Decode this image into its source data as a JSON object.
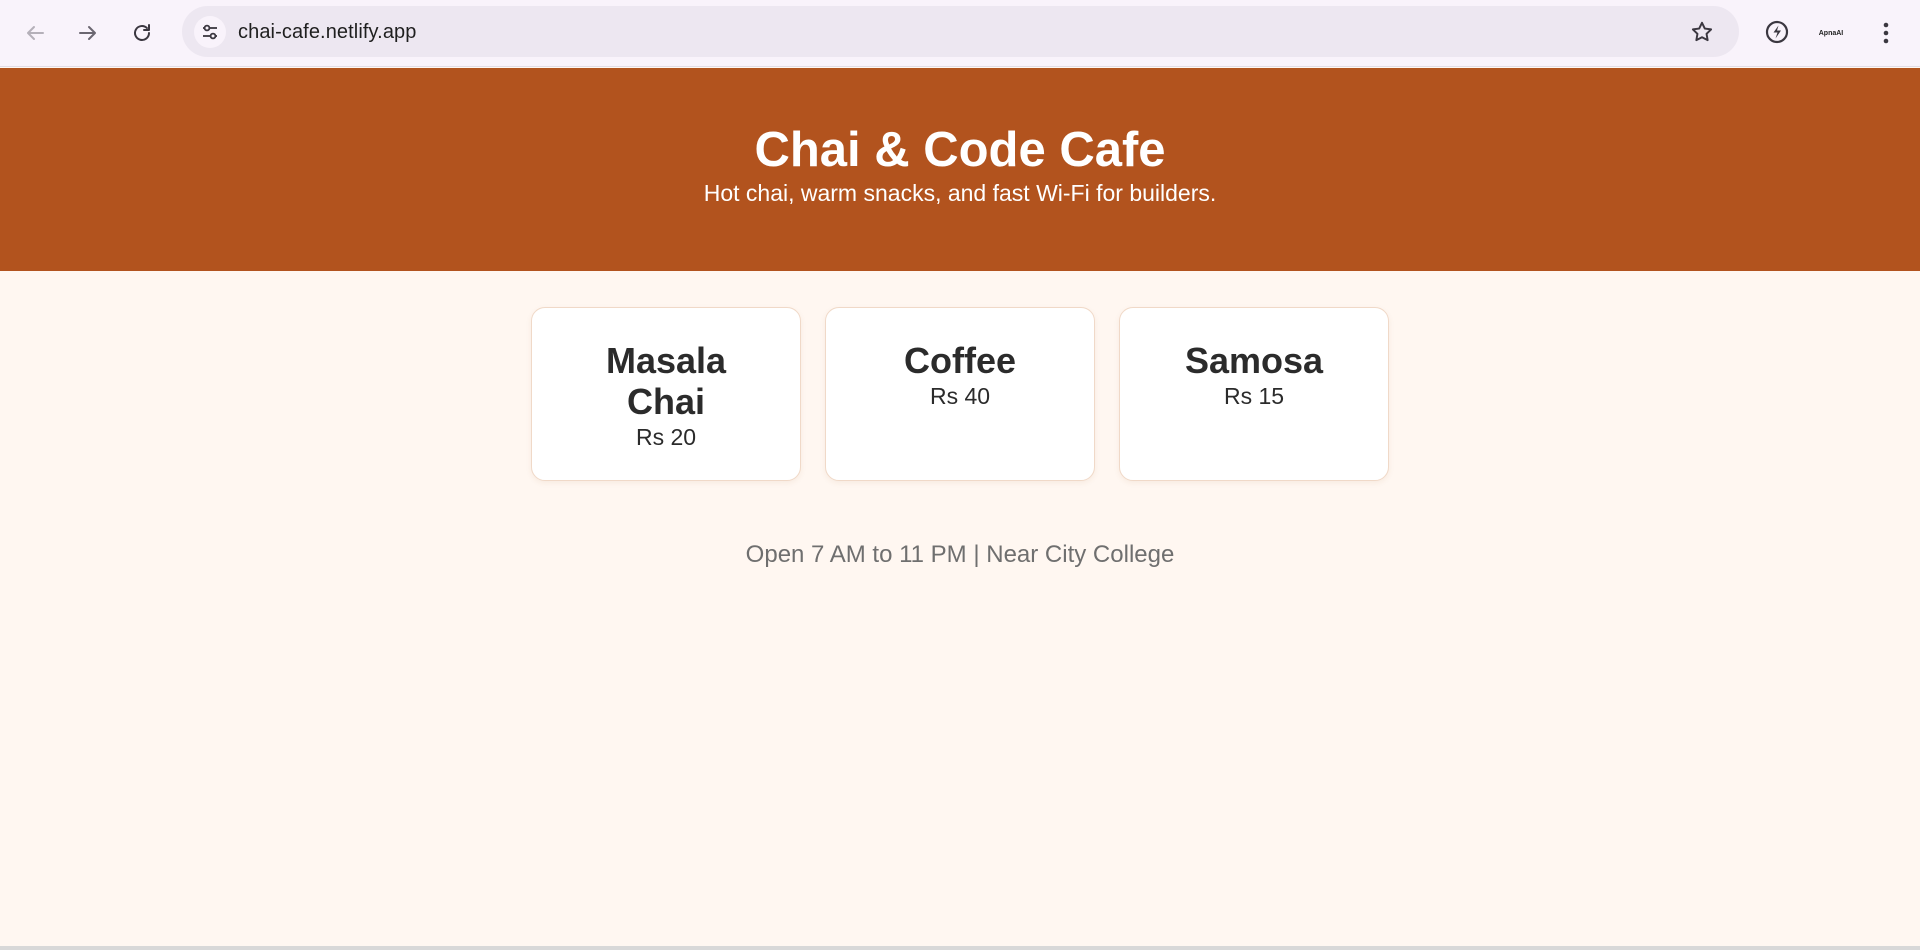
{
  "browser": {
    "url": "chai-cafe.netlify.app",
    "profile_label": "ApnaAI",
    "icons": {
      "back": "arrow-left-icon",
      "forward": "arrow-right-icon",
      "reload": "reload-icon",
      "site_info": "tune-icon",
      "bookmark": "star-icon",
      "extension": "leaf-bolt-icon",
      "menu": "three-dots-icon"
    }
  },
  "hero": {
    "title": "Chai & Code Cafe",
    "tagline": "Hot chai, warm snacks, and fast Wi-Fi for builders.",
    "background": "#b2531e"
  },
  "menu": {
    "items": [
      {
        "name": "Masala Chai",
        "price": "Rs 20"
      },
      {
        "name": "Coffee",
        "price": "Rs 40"
      },
      {
        "name": "Samosa",
        "price": "Rs 15"
      }
    ]
  },
  "footer": {
    "note": "Open 7 AM to 11 PM | Near City College"
  },
  "colors": {
    "page_bg": "#fff7f1",
    "accent": "#b2531e",
    "card_text": "#2b2b2b",
    "muted_text": "#6f6f6f"
  }
}
